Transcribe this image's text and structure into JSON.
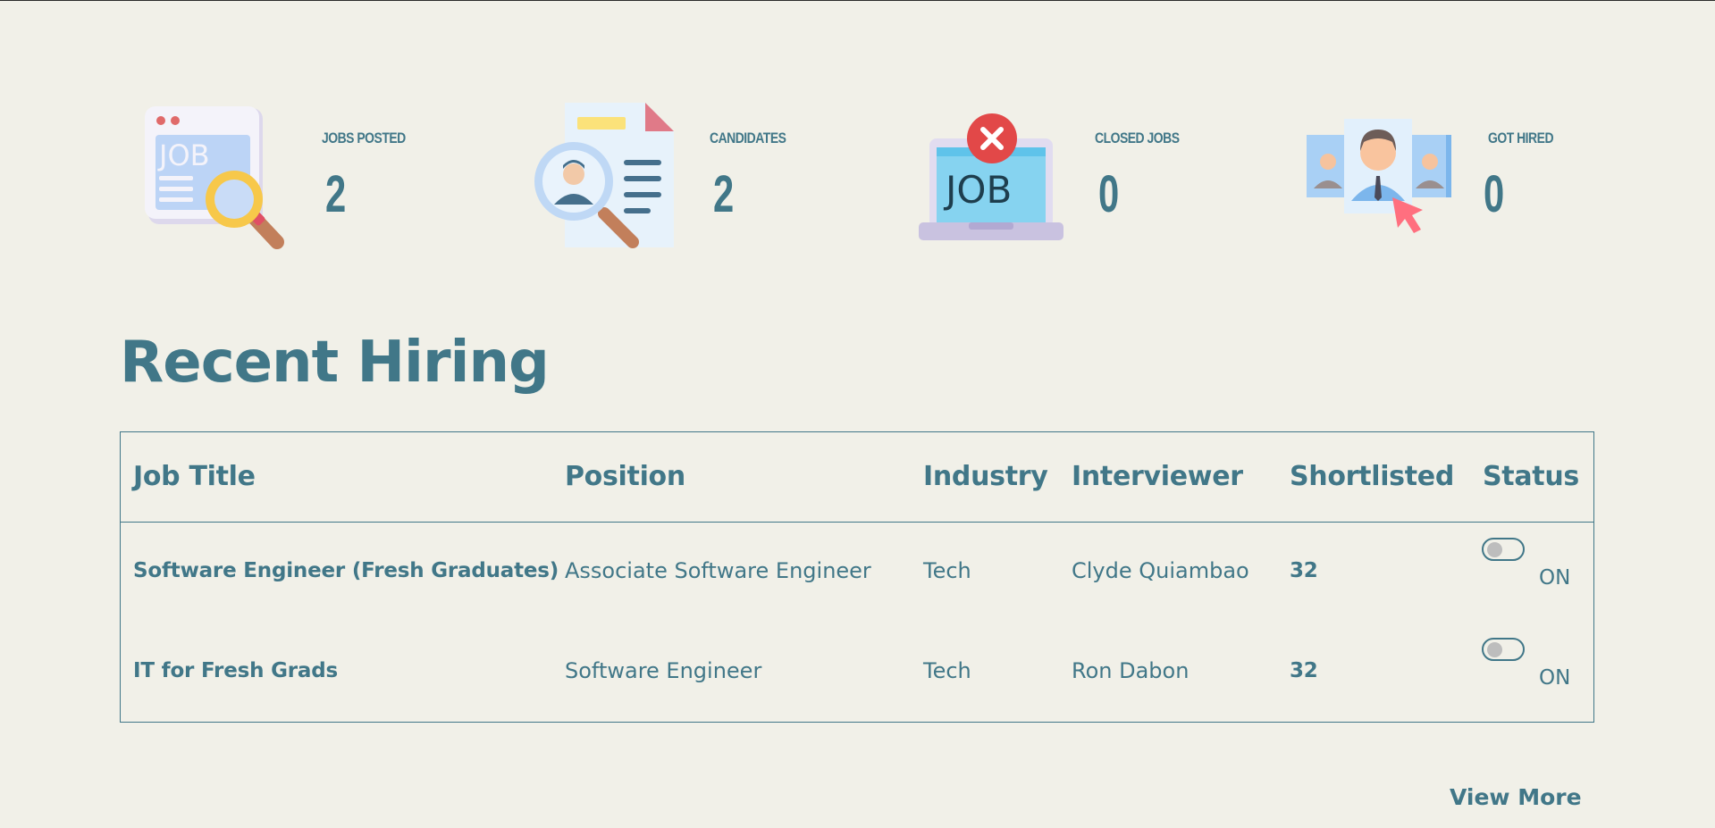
{
  "stats": [
    {
      "label": "JOBS POSTED",
      "value": "2",
      "icon": "job-search-icon"
    },
    {
      "label": "CANDIDATES",
      "value": "2",
      "icon": "candidate-resume-icon"
    },
    {
      "label": "CLOSED JOBS",
      "value": "0",
      "icon": "closed-job-laptop-icon"
    },
    {
      "label": "GOT HIRED",
      "value": "0",
      "icon": "hired-person-icon"
    }
  ],
  "recent": {
    "title": "Recent Hiring",
    "columns": [
      "Job Title",
      "Position",
      "Industry",
      "Interviewer",
      "Shortlisted",
      "Status"
    ],
    "rows": [
      {
        "job_title": "Software Engineer (Fresh Graduates)",
        "position": "Associate Software Engineer",
        "industry": "Tech",
        "interviewer": "Clyde Quiambao",
        "shortlisted": "32",
        "status": "ON"
      },
      {
        "job_title": "IT for Fresh Grads",
        "position": "Software Engineer",
        "industry": "Tech",
        "interviewer": "Ron Dabon",
        "shortlisted": "32",
        "status": "ON"
      }
    ],
    "view_more": "View More"
  },
  "colors": {
    "background": "#f1f0e8",
    "primary": "#417788"
  }
}
